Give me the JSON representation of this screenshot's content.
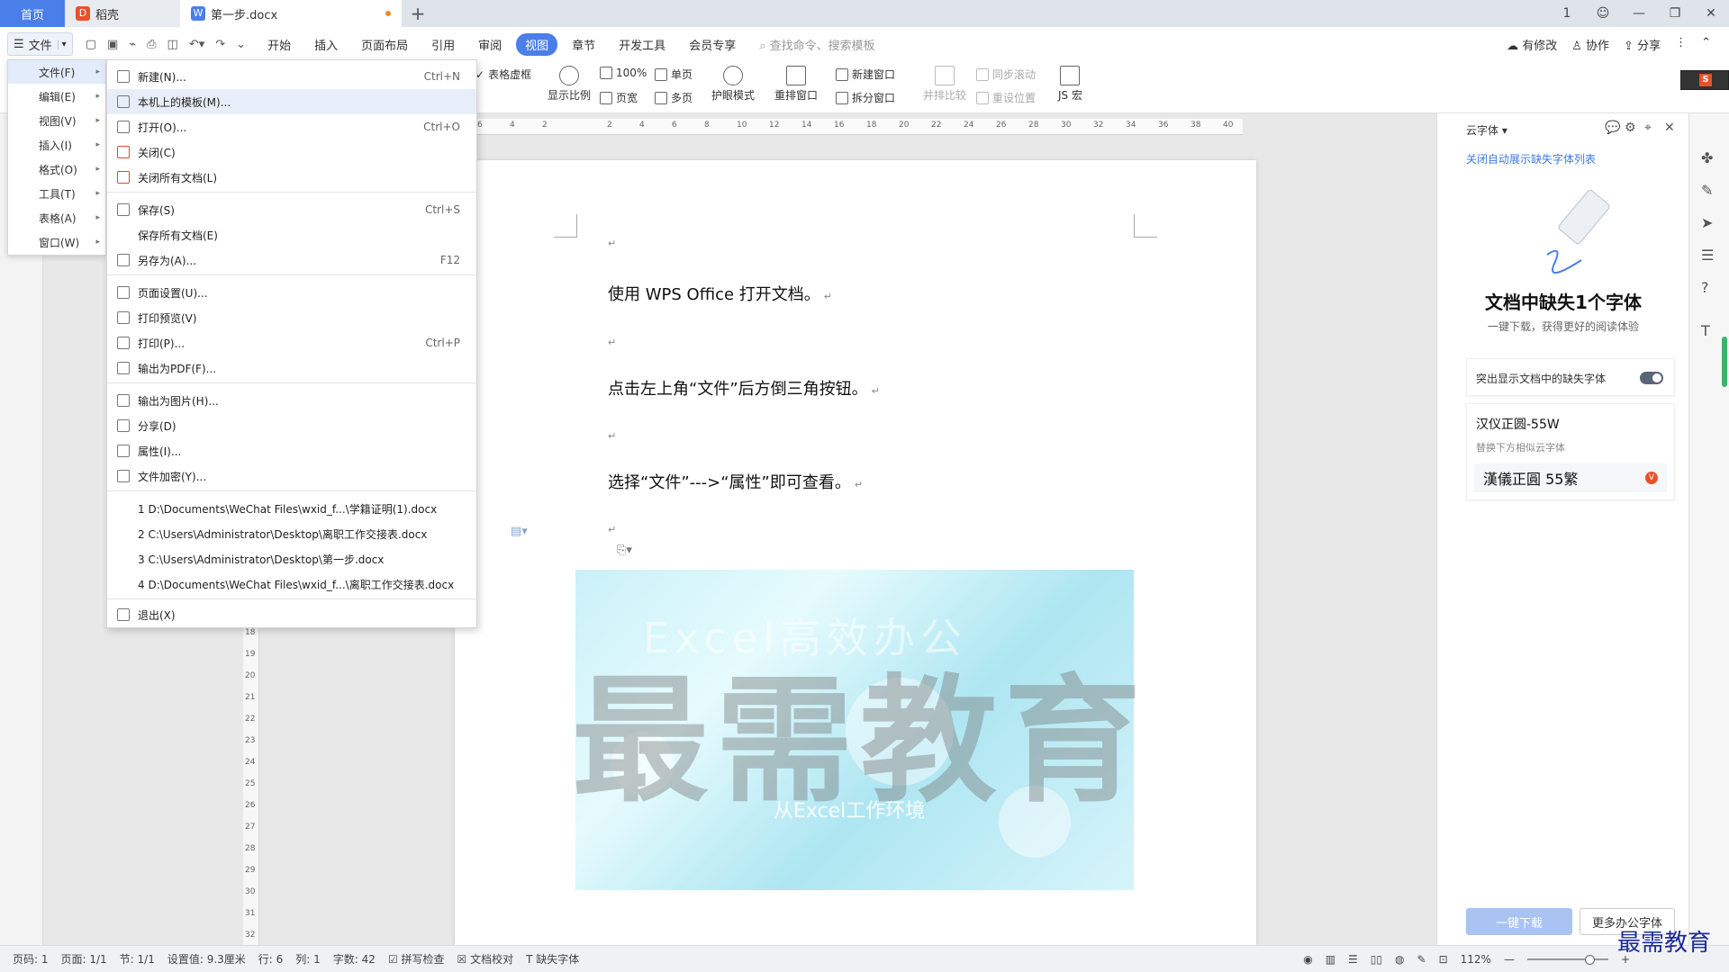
{
  "titlebar": {
    "tabs": [
      {
        "label": "首页",
        "icon": "home-icon"
      },
      {
        "label": "稻壳",
        "icon": "docer-icon"
      },
      {
        "label": "第一步.docx",
        "icon": "word-doc-icon",
        "unsaved": true
      }
    ],
    "new_tab": "+",
    "window_controls": [
      "1",
      "user-avatar",
      "—",
      "❐",
      "✕"
    ]
  },
  "menubar": {
    "file_label": "文件",
    "tabs": [
      "开始",
      "插入",
      "页面布局",
      "引用",
      "审阅",
      "视图",
      "章节",
      "开发工具",
      "会员专享"
    ],
    "active_tab": "视图",
    "search_placeholder": "查找命令、搜索模板",
    "right": [
      "有修改",
      "协作",
      "分享"
    ]
  },
  "ribbon": {
    "table_gridlines": "表格虚框",
    "zoom_label": "显示比例",
    "zoom_100": "100%",
    "single_page": "单页",
    "page_width": "页宽",
    "multi_page": "多页",
    "eye_mode": "护眼模式",
    "rearrange": "重排窗口",
    "new_window": "新建窗口",
    "split_window": "拆分窗口",
    "side_by_side": "并排比较",
    "sync_scroll": "同步滚动",
    "reset_position": "重设位置",
    "js_macro": "JS 宏"
  },
  "submenu": {
    "items": [
      {
        "label": "文件(F)",
        "active": true
      },
      {
        "label": "编辑(E)"
      },
      {
        "label": "视图(V)"
      },
      {
        "label": "插入(I)"
      },
      {
        "label": "格式(O)"
      },
      {
        "label": "工具(T)"
      },
      {
        "label": "表格(A)"
      },
      {
        "label": "窗口(W)"
      }
    ]
  },
  "filemenu": {
    "groups": [
      [
        {
          "label": "新建(N)...",
          "shortcut": "Ctrl+N"
        },
        {
          "label": "本机上的模板(M)...",
          "shortcut": "",
          "hover": true
        },
        {
          "label": "打开(O)...",
          "shortcut": "Ctrl+O"
        },
        {
          "label": "关闭(C)",
          "shortcut": ""
        },
        {
          "label": "关闭所有文档(L)",
          "shortcut": ""
        }
      ],
      [
        {
          "label": "保存(S)",
          "shortcut": "Ctrl+S"
        },
        {
          "label": "保存所有文档(E)",
          "shortcut": ""
        },
        {
          "label": "另存为(A)...",
          "shortcut": "F12"
        }
      ],
      [
        {
          "label": "页面设置(U)...",
          "shortcut": ""
        },
        {
          "label": "打印预览(V)",
          "shortcut": ""
        },
        {
          "label": "打印(P)...",
          "shortcut": "Ctrl+P"
        },
        {
          "label": "输出为PDF(F)...",
          "shortcut": ""
        }
      ],
      [
        {
          "label": "输出为图片(H)...",
          "shortcut": ""
        },
        {
          "label": "分享(D)",
          "shortcut": ""
        },
        {
          "label": "属性(I)...",
          "shortcut": ""
        },
        {
          "label": "文件加密(Y)...",
          "shortcut": ""
        }
      ],
      [
        {
          "label": "1 D:\\Documents\\WeChat Files\\wxid_f...\\学籍证明(1).docx",
          "shortcut": ""
        },
        {
          "label": "2 C:\\Users\\Administrator\\Desktop\\离职工作交接表.docx",
          "shortcut": ""
        },
        {
          "label": "3 C:\\Users\\Administrator\\Desktop\\第一步.docx",
          "shortcut": ""
        },
        {
          "label": "4 D:\\Documents\\WeChat Files\\wxid_f...\\离职工作交接表.docx",
          "shortcut": ""
        }
      ],
      [
        {
          "label": "退出(X)",
          "shortcut": ""
        }
      ]
    ]
  },
  "ruler": {
    "h_ticks": [
      "6",
      "4",
      "2",
      "2",
      "4",
      "6",
      "8",
      "10",
      "12",
      "14",
      "16",
      "18",
      "20",
      "22",
      "24",
      "26",
      "28",
      "30",
      "32",
      "34",
      "36",
      "38",
      "40"
    ],
    "v_ticks": [
      "18",
      "19",
      "20",
      "21",
      "22",
      "23",
      "24",
      "25",
      "26",
      "27",
      "28",
      "29",
      "30",
      "31",
      "32"
    ]
  },
  "document": {
    "paragraphs": [
      "使用 WPS Office 打开文档。",
      "点击左上角“文件”后方倒三角按钮。",
      "选择“文件”--->“属性”即可查看。"
    ],
    "para_mark": "↵",
    "image_text_1": "Excel高效办公",
    "image_text_2": "从Excel工作环境"
  },
  "watermark": {
    "text": "最需教育",
    "corner": "最需教育"
  },
  "rightpanel": {
    "header": "云字体",
    "link": "关闭自动展示缺失字体列表",
    "title": "文档中缺失1个字体",
    "subtitle": "一键下载，获得更好的阅读体验",
    "toggle_label": "突出显示文档中的缺失字体",
    "font_name": "汉仪正圆-55W",
    "font_hint": "替换下方相似云字体",
    "font_sample": "漢儀正圓 55繁",
    "btn_download": "一键下载",
    "btn_more": "更多办公字体"
  },
  "statusbar": {
    "page_no": "页码: 1",
    "pages": "页面: 1/1",
    "section": "节: 1/1",
    "setting": "设置值: 9.3厘米",
    "row": "行: 6",
    "col": "列: 1",
    "word_count": "字数: 42",
    "spell_check": "拼写检查",
    "doc_check": "文档校对",
    "missing_font": "缺失字体",
    "zoom": "112%"
  },
  "colors": {
    "accent": "#4a7ee8",
    "watermark": "#787878",
    "corner_watermark": "#1a2a9a"
  }
}
